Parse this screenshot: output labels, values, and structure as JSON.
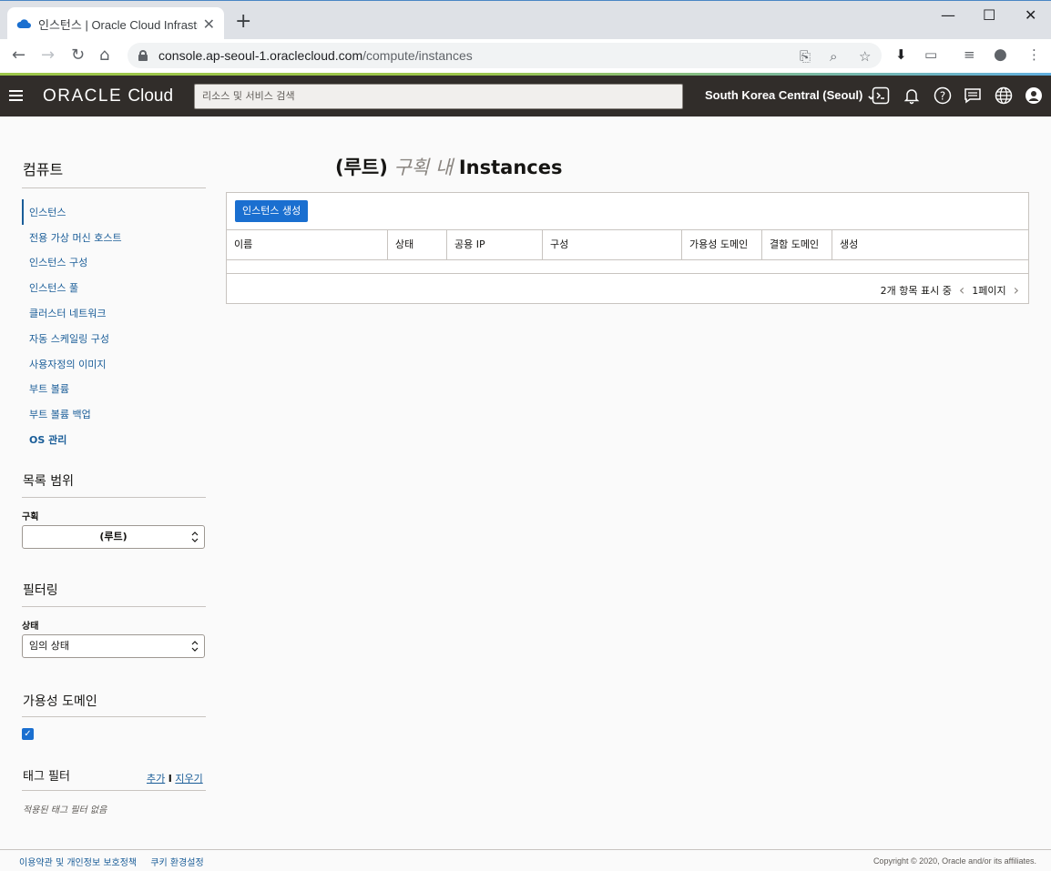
{
  "browser": {
    "tab_title": "인스턴스 | Oracle Cloud Infrastru",
    "new_tab": "+",
    "url_host": "console.ap-seoul-1.oraclecloud.com",
    "url_path": "/compute/instances",
    "window_controls": [
      "minimize",
      "maximize",
      "close"
    ]
  },
  "header": {
    "logo": "ORACLE",
    "logo_suffix": "Cloud",
    "search_placeholder": "리소스 및 서비스 검색",
    "region": "South Korea Central (Seoul)"
  },
  "sidebar": {
    "section_title": "컴퓨트",
    "items": [
      {
        "label": "인스턴스",
        "active": true
      },
      {
        "label": "전용 가상 머신 호스트"
      },
      {
        "label": "인스턴스 구성"
      },
      {
        "label": "인스턴스 풀"
      },
      {
        "label": "클러스터 네트워크"
      },
      {
        "label": "자동 스케일링 구성"
      },
      {
        "label": "사용자정의 이미지"
      },
      {
        "label": "부트 볼륨"
      },
      {
        "label": "부트 볼륨 백업"
      },
      {
        "label": "OS 관리",
        "bold": true
      }
    ],
    "scope_title": "목록 범위",
    "compartment_label": "구획",
    "compartment_value": "(루트)",
    "filter_title": "필터링",
    "state_label": "상태",
    "state_value": "임의 상태",
    "ad_title": "가용성 도메인",
    "ad_checked": true,
    "tag_title": "태그 필터",
    "tag_add": "추가",
    "tag_separator": "I",
    "tag_clear": "지우기",
    "no_tags": "적용된 태그 필터 없음"
  },
  "main": {
    "title_compartment": "(루트)",
    "title_in": "구획 내",
    "title_resource": "Instances",
    "create_button": "인스턴스 생성",
    "columns": [
      "이름",
      "상태",
      "공용 IP",
      "구성",
      "가용성 도메인",
      "결함 도메인",
      "생성"
    ],
    "pager_text": "2개 항목 표시 중",
    "pager_page": "1페이지"
  },
  "footer": {
    "terms": "이용약관 및 개인정보 보호정책",
    "cookies": "쿠키 환경설정",
    "copyright": "Copyright © 2020, Oracle and/or its affiliates."
  },
  "colors": {
    "header_bg": "#312d2a",
    "link": "#1a5d98",
    "primary_button": "#1a6fd0"
  }
}
